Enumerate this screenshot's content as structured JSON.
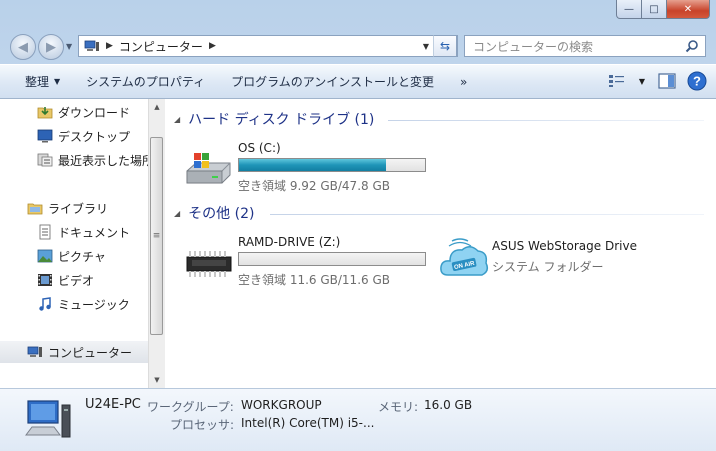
{
  "window": {
    "caption_min": "—",
    "caption_max": "□",
    "caption_close": "✕"
  },
  "nav": {
    "back_icon": "arrow-left",
    "forward_icon": "arrow-right",
    "path": [
      "コンピューター"
    ],
    "search_placeholder": "コンピューターの検索"
  },
  "toolbar": {
    "organize_label": "整理",
    "system_properties_label": "システムのプロパティ",
    "uninstall_label": "プログラムのアンインストールと変更",
    "more_label": "»"
  },
  "sidebar": {
    "favorites": [
      {
        "label": "ダウンロード",
        "icon": "download-folder-icon"
      },
      {
        "label": "デスクトップ",
        "icon": "desktop-icon"
      },
      {
        "label": "最近表示した場所",
        "icon": "recent-places-icon"
      }
    ],
    "libraries_label": "ライブラリ",
    "libraries": [
      {
        "label": "ドキュメント",
        "icon": "document-icon"
      },
      {
        "label": "ピクチャ",
        "icon": "picture-icon"
      },
      {
        "label": "ビデオ",
        "icon": "video-icon"
      },
      {
        "label": "ミュージック",
        "icon": "music-icon"
      }
    ],
    "computer_label": "コンピューター"
  },
  "main": {
    "groups": [
      {
        "header": "ハード ディスク ドライブ (1)",
        "items": [
          {
            "name": "OS (C:)",
            "free_text": "空き領域 9.92 GB/47.8 GB",
            "used_fraction": 0.79
          }
        ]
      },
      {
        "header": "その他 (2)",
        "items": [
          {
            "name": "RAMD-DRIVE (Z:)",
            "free_text": "空き領域 11.6 GB/11.6 GB",
            "used_fraction": 0.0
          },
          {
            "name": "ASUS WebStorage Drive",
            "type": "システム フォルダー"
          }
        ]
      }
    ]
  },
  "details": {
    "pc_name": "U24E-PC",
    "workgroup_label": "ワークグループ:",
    "workgroup_value": "WORKGROUP",
    "memory_label": "メモリ:",
    "memory_value": "16.0 GB",
    "processor_label": "プロセッサ:",
    "processor_value": "Intel(R) Core(TM) i5-..."
  },
  "colors": {
    "bar_fill": "#1f95b8",
    "group_header": "#1e3287",
    "close_button": "#c8432a"
  }
}
